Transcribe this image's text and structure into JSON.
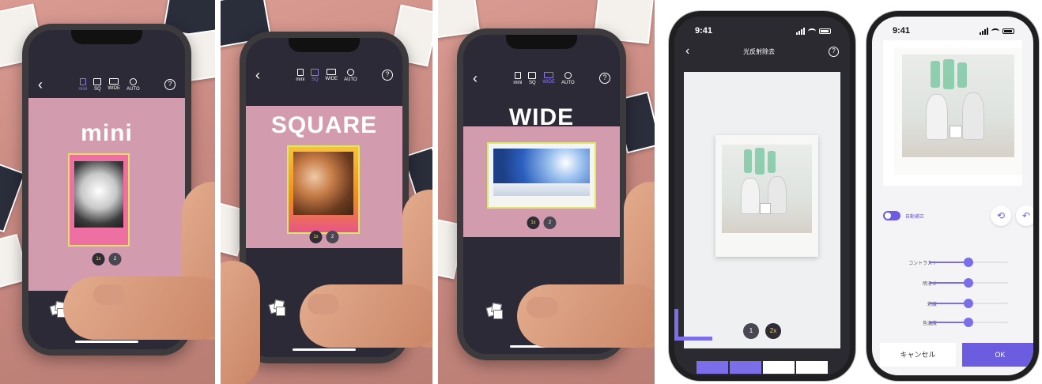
{
  "panels": [
    {
      "format_label": "mini",
      "modes": [
        "mini",
        "SQ",
        "WIDE",
        "AUTO"
      ],
      "active_mode": "mini",
      "zoom": [
        "1x",
        "2"
      ],
      "zoom_active": "1x"
    },
    {
      "format_label": "SQUARE",
      "modes": [
        "mini",
        "SQ",
        "WIDE",
        "AUTO"
      ],
      "active_mode": "SQ",
      "zoom": [
        "1x",
        "2"
      ],
      "zoom_active": "1x"
    },
    {
      "format_label": "WIDE",
      "modes": [
        "mini",
        "SQ",
        "WIDE",
        "AUTO"
      ],
      "active_mode": "WIDE",
      "zoom": [
        "1x",
        "2"
      ],
      "zoom_active": "1x"
    }
  ],
  "glare_screen": {
    "time": "9:41",
    "title": "光反射除去",
    "zoom": [
      "1",
      "2x"
    ],
    "zoom_active": "2x",
    "progress_segments": 4,
    "progress_filled": 2,
    "accent": "#7b6ee8"
  },
  "adjust_screen": {
    "time": "9:41",
    "auto_correct_label": "自動補正",
    "auto_correct_on": true,
    "sliders": [
      {
        "label": "コントラスト",
        "value": 0.5
      },
      {
        "label": "明るさ",
        "value": 0.5
      },
      {
        "label": "彩度",
        "value": 0.5
      },
      {
        "label": "色温度",
        "value": 0.5
      }
    ],
    "cancel_label": "キャンセル",
    "ok_label": "OK",
    "accent": "#6b5ce0"
  },
  "icons": {
    "back": "back-chevron-icon",
    "help": "help-icon",
    "gallery": "gallery-icon",
    "rotate": "rotate-icon",
    "undo": "undo-icon"
  }
}
